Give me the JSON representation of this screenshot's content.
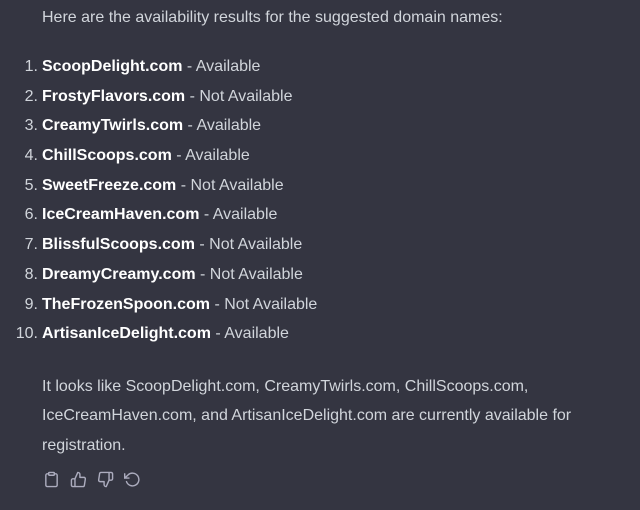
{
  "message": {
    "intro": "Here are the availability results for the suggested domain names:",
    "results": [
      {
        "number": "1.",
        "domain": "ScoopDelight.com",
        "separator": " - ",
        "status": "Available"
      },
      {
        "number": "2.",
        "domain": "FrostyFlavors.com",
        "separator": " - ",
        "status": "Not Available"
      },
      {
        "number": "3.",
        "domain": "CreamyTwirls.com",
        "separator": " - ",
        "status": "Available"
      },
      {
        "number": "4.",
        "domain": "ChillScoops.com",
        "separator": " - ",
        "status": "Available"
      },
      {
        "number": "5.",
        "domain": "SweetFreeze.com",
        "separator": " - ",
        "status": "Not Available"
      },
      {
        "number": "6.",
        "domain": "IceCreamHaven.com",
        "separator": " - ",
        "status": "Available"
      },
      {
        "number": "7.",
        "domain": "BlissfulScoops.com",
        "separator": " - ",
        "status": "Not Available"
      },
      {
        "number": "8.",
        "domain": "DreamyCreamy.com",
        "separator": " - ",
        "status": "Not Available"
      },
      {
        "number": "9.",
        "domain": "TheFrozenSpoon.com",
        "separator": " - ",
        "status": "Not Available"
      },
      {
        "number": "10.",
        "domain": "ArtisanIceDelight.com",
        "separator": " - ",
        "status": "Available"
      }
    ],
    "summary": "It looks like ScoopDelight.com, CreamyTwirls.com, ChillScoops.com, IceCreamHaven.com, and ArtisanIceDelight.com are currently available for registration."
  },
  "actions": [
    {
      "icon": "clipboard-icon"
    },
    {
      "icon": "thumbs-up-icon"
    },
    {
      "icon": "thumbs-down-icon"
    },
    {
      "icon": "regenerate-icon"
    }
  ],
  "colors": {
    "background": "#343541",
    "text": "#d1d5db",
    "strong": "#ffffff",
    "icon": "#acacbe"
  }
}
